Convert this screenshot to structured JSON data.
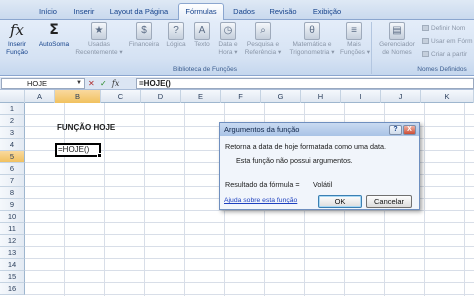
{
  "tabs": [
    {
      "label": "Início",
      "active": false
    },
    {
      "label": "Inserir",
      "active": false
    },
    {
      "label": "Layout da Página",
      "active": false
    },
    {
      "label": "Fórmulas",
      "active": true
    },
    {
      "label": "Dados",
      "active": false
    },
    {
      "label": "Revisão",
      "active": false
    },
    {
      "label": "Exibição",
      "active": false
    }
  ],
  "ribbon": {
    "inserir_funcao": [
      "Inserir",
      "Função"
    ],
    "autosoma": "AutoSoma",
    "usadas": [
      "Usadas",
      "Recentemente ▾"
    ],
    "financeira": "Financeira",
    "logica": "Lógica",
    "texto": "Texto",
    "data_hora": [
      "Data e",
      "Hora ▾"
    ],
    "pesquisa": [
      "Pesquisa e",
      "Referência ▾"
    ],
    "matematica": [
      "Matemática e",
      "Trigonometria ▾"
    ],
    "mais": [
      "Mais",
      "Funções ▾"
    ],
    "gerenciador": [
      "Gerenciador",
      "de Nomes"
    ],
    "definir_nome": "Definir Nom",
    "usar_formula": "Usar em Fórm",
    "criar_partir": "Criar a partir",
    "group_biblioteca": "Biblioteca de Funções",
    "group_nomes": "Nomes Definidos"
  },
  "formula_bar": {
    "name_box": "HOJE",
    "cancel_glyph": "✕",
    "enter_glyph": "✓",
    "fx": "fx",
    "formula": "=HOJE()"
  },
  "columns": [
    "A",
    "B",
    "C",
    "D",
    "E",
    "F",
    "G",
    "H",
    "I",
    "J",
    "K"
  ],
  "rows": [
    "1",
    "2",
    "3",
    "4",
    "5",
    "6",
    "7",
    "8",
    "9",
    "10",
    "11",
    "12",
    "13",
    "14",
    "15",
    "16"
  ],
  "cells": {
    "b3": "FUNÇÃO HOJE",
    "b5": "=HOJE()"
  },
  "dialog": {
    "title": "Argumentos da função",
    "help": "?",
    "close": "X",
    "description": "Retorna a data de hoje formatada como uma data.",
    "no_args": "Esta função não possui argumentos.",
    "result_label": "Resultado da fórmula =",
    "result_value": "Volátil",
    "help_link": "Ajuda sobre esta função",
    "ok": "OK",
    "cancel": "Cancelar"
  }
}
